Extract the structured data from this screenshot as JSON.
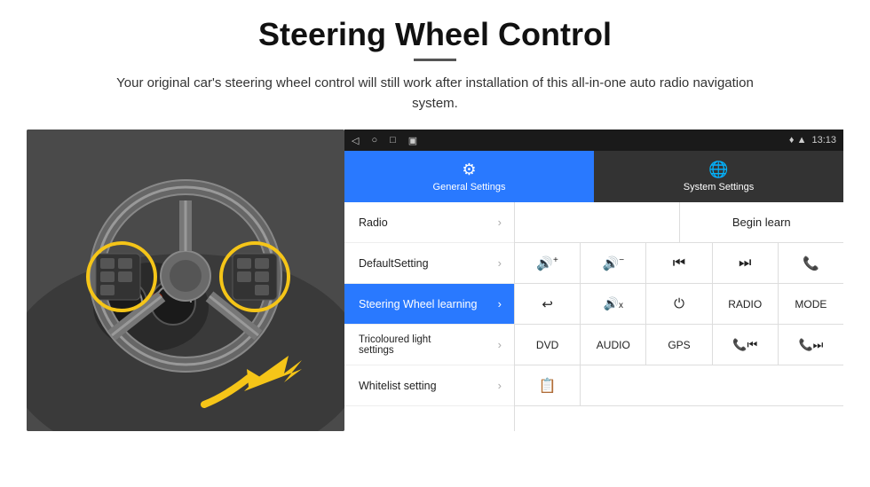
{
  "page": {
    "title": "Steering Wheel Control",
    "description": "Your original car's steering wheel control will still work after installation of this all-in-one auto radio navigation system."
  },
  "status_bar": {
    "time": "13:13",
    "nav_icons": [
      "◁",
      "○",
      "□",
      "▣"
    ],
    "right_icons": "♦ ▲"
  },
  "tabs": {
    "general": {
      "label": "General Settings",
      "icon": "⚙"
    },
    "system": {
      "label": "System Settings",
      "icon": "🌐"
    }
  },
  "menu_items": [
    {
      "label": "Radio",
      "active": false
    },
    {
      "label": "DefaultSetting",
      "active": false
    },
    {
      "label": "Steering Wheel learning",
      "active": true
    },
    {
      "label": "Tricoloured light settings",
      "active": false
    },
    {
      "label": "Whitelist setting",
      "active": false
    }
  ],
  "controls": {
    "begin_learn_label": "Begin learn",
    "rows": [
      [
        "🔊+",
        "🔊−",
        "⏮",
        "⏭",
        "📞"
      ],
      [
        "↩",
        "🔊x",
        "⏻",
        "RADIO",
        "MODE"
      ],
      [
        "DVD",
        "AUDIO",
        "GPS",
        "📞⏮",
        "📞⏭"
      ],
      [
        "📋"
      ]
    ],
    "row_labels": [
      [
        "vol+",
        "vol-",
        "prev",
        "next",
        "call"
      ],
      [
        "back",
        "mute",
        "power",
        "RADIO",
        "MODE"
      ],
      [
        "DVD",
        "AUDIO",
        "GPS",
        "tel-prev",
        "tel-next"
      ],
      [
        "list"
      ]
    ]
  }
}
